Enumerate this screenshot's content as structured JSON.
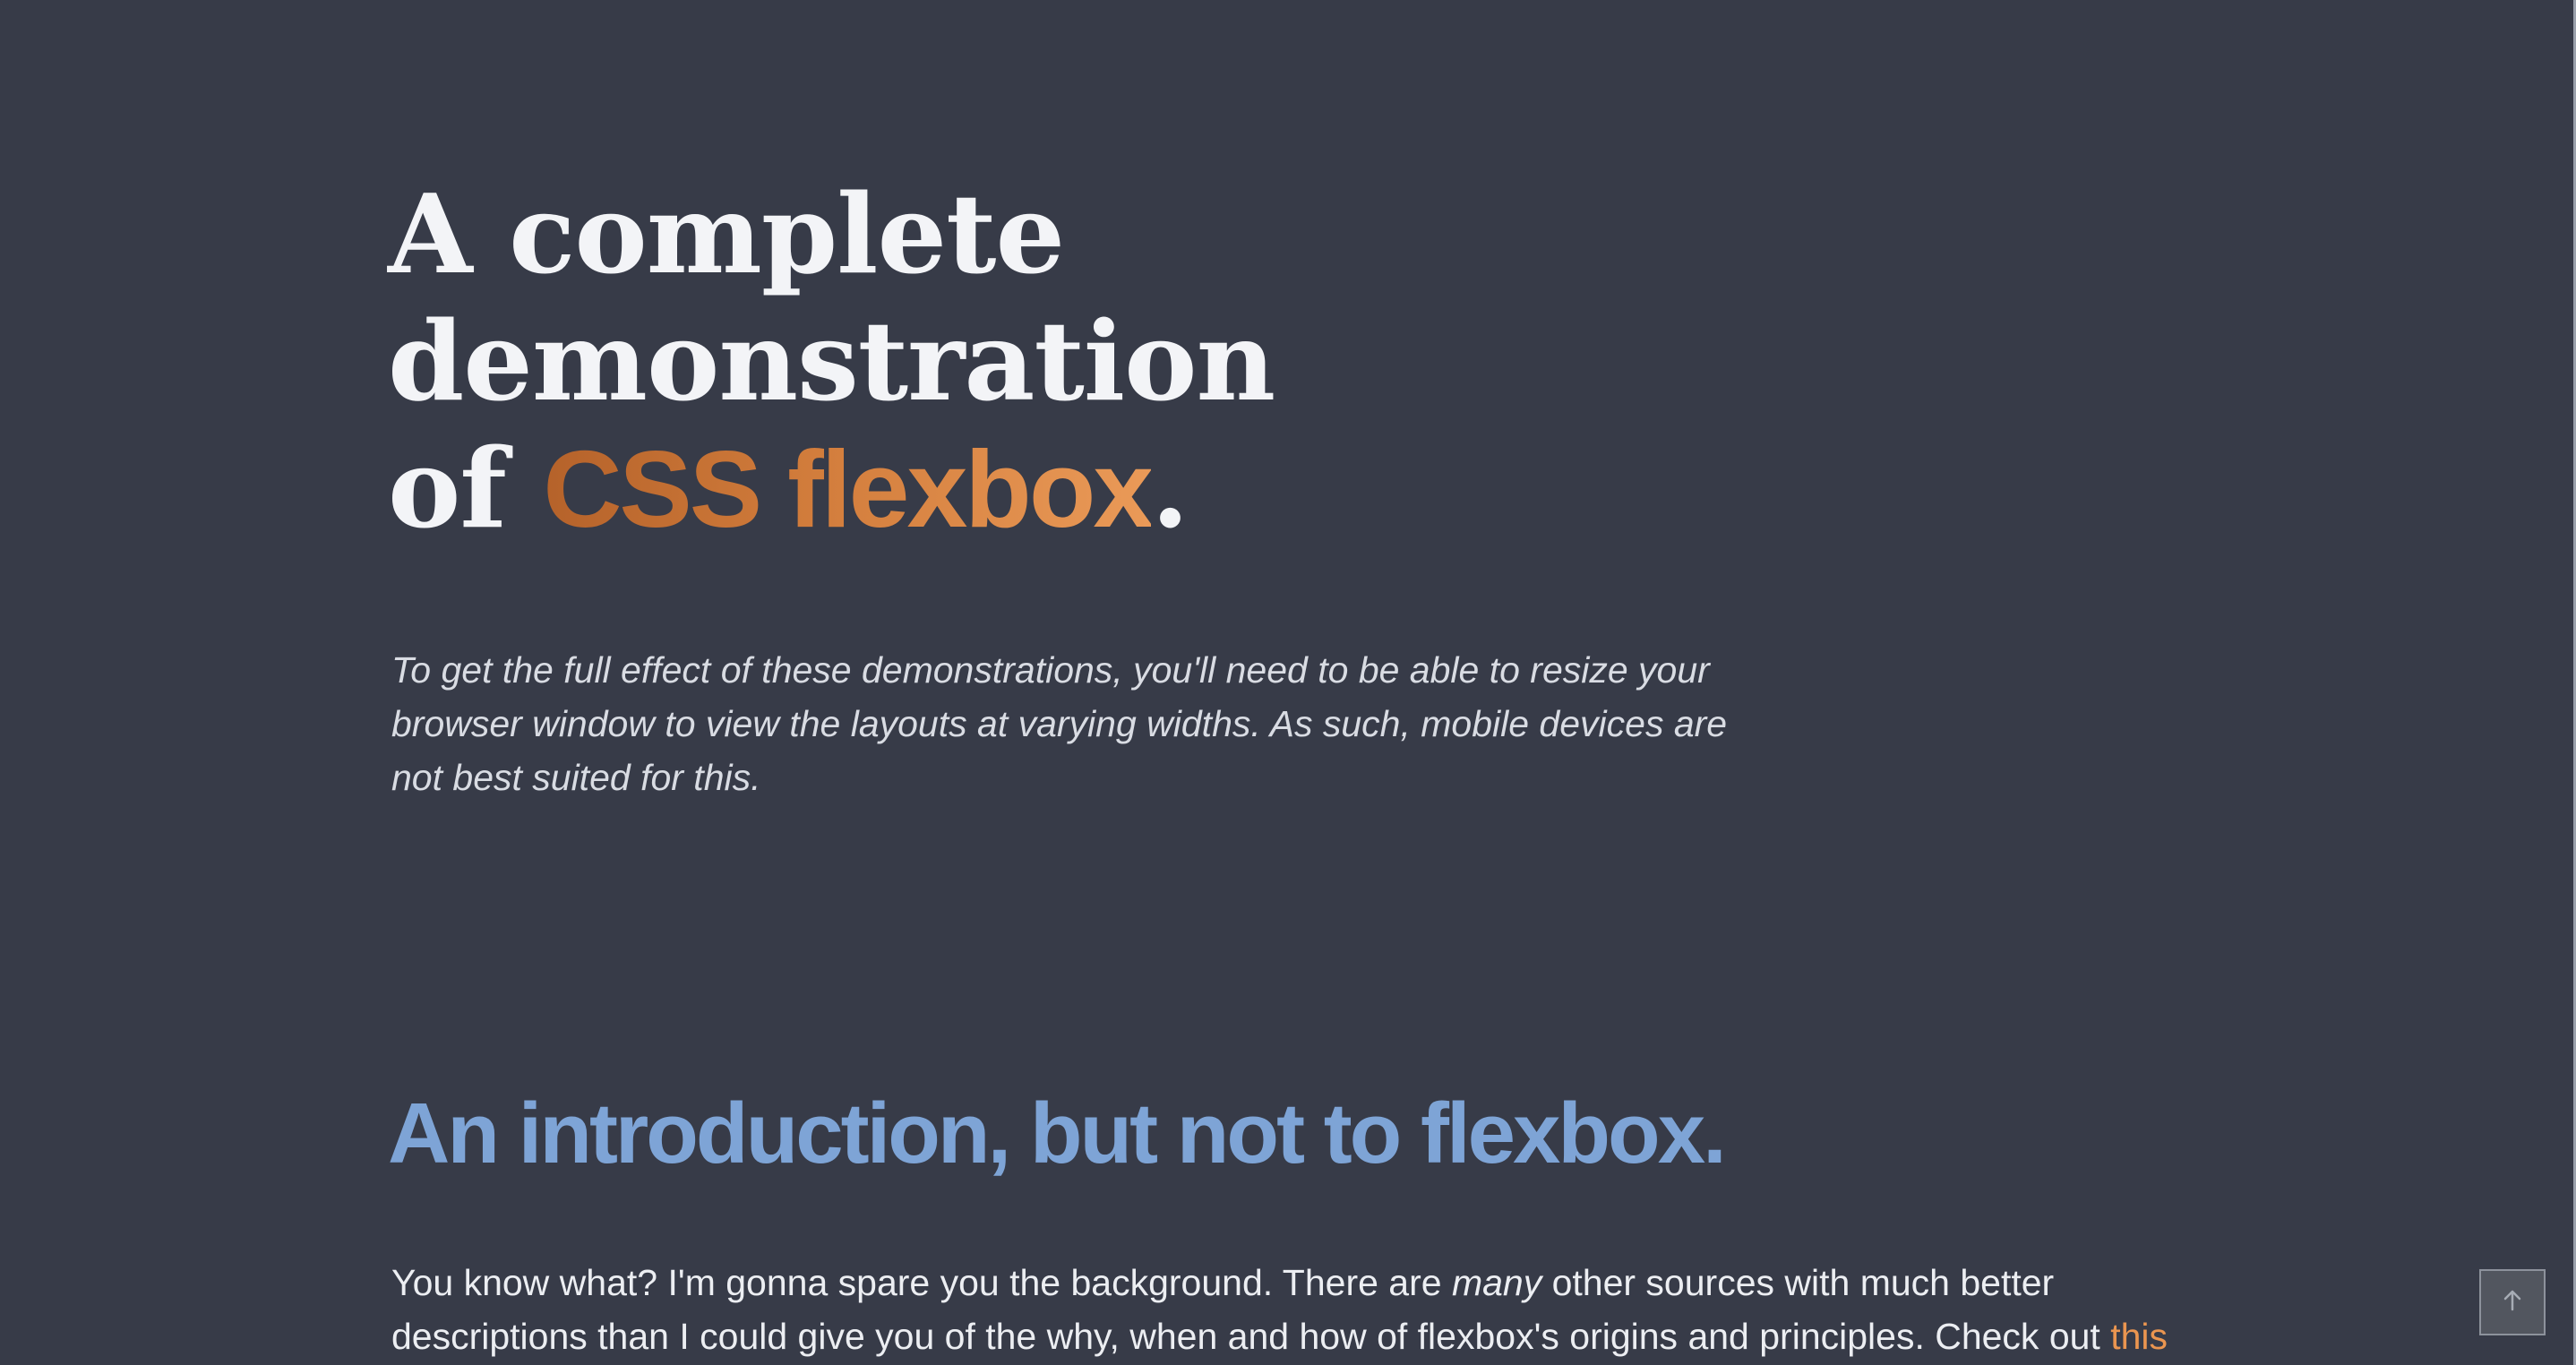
{
  "hero": {
    "title_line1": "A complete",
    "title_line2": "demonstration",
    "title_prefix": "of ",
    "title_accent": "CSS flexbox",
    "title_suffix": ".",
    "note": "To get the full effect of these demonstrations, you'll need to be able to resize your browser window to view the layouts at varying widths. As such, mobile devices are not best suited for this."
  },
  "section": {
    "heading": "An introduction, but not to flexbox.",
    "paragraph_part1": "You know what? I'm gonna spare you the background. There are ",
    "paragraph_emphasis": "many",
    "paragraph_part2": " other sources with much better descriptions than I could give you of the why, when and how of flexbox's origins and principles. Check out ",
    "paragraph_link": "this"
  },
  "scroll_top_button": {
    "icon": "arrow-up-icon"
  },
  "colors": {
    "background": "#373b48",
    "title": "#f3f4f7",
    "accent_start": "#b5622a",
    "accent_end": "#ea9a58",
    "heading": "#7ea4d6",
    "link": "#ea9550"
  }
}
